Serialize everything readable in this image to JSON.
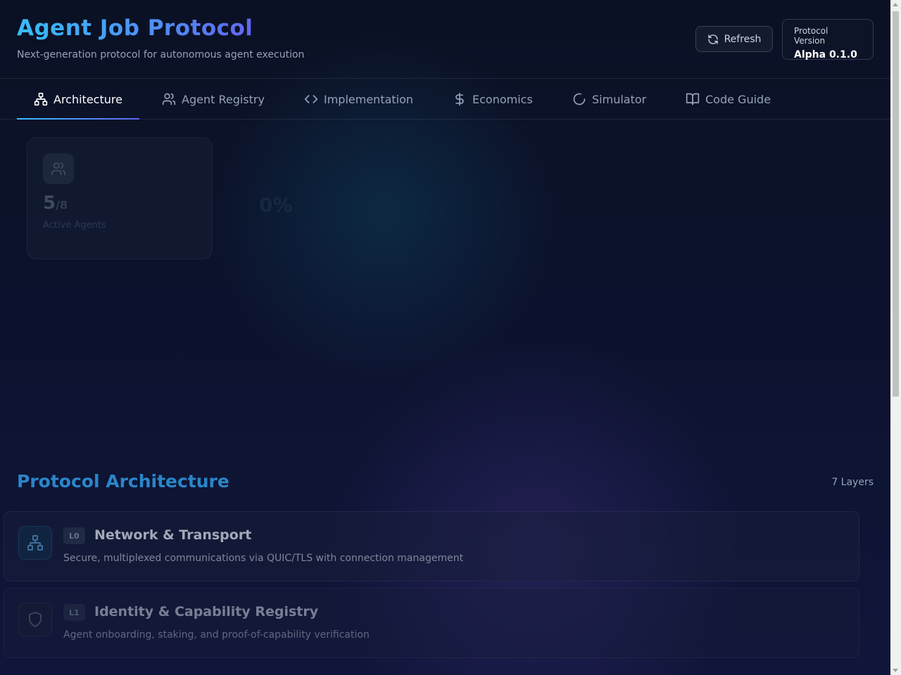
{
  "header": {
    "title": "Agent Job Protocol",
    "subtitle": "Next-generation protocol for autonomous agent execution",
    "refresh_label": "Refresh",
    "version_label": "Protocol Version",
    "version_value": "Alpha 0.1.0"
  },
  "tabs": [
    {
      "label": "Architecture",
      "icon": "network-icon",
      "active": true
    },
    {
      "label": "Agent Registry",
      "icon": "users-icon",
      "active": false
    },
    {
      "label": "Implementation",
      "icon": "code-icon",
      "active": false
    },
    {
      "label": "Economics",
      "icon": "dollar-icon",
      "active": false
    },
    {
      "label": "Simulator",
      "icon": "loader-icon",
      "active": false
    },
    {
      "label": "Code Guide",
      "icon": "book-icon",
      "active": false
    }
  ],
  "stats": [
    {
      "value": "5",
      "total": "/8",
      "label": "Active Agents",
      "icon": "users-icon"
    },
    {
      "value": "0%",
      "label": "",
      "icon": ""
    }
  ],
  "section": {
    "title": "Protocol Architecture",
    "count": "7 Layers"
  },
  "layers": [
    {
      "badge": "L0",
      "name": "Network & Transport",
      "description": "Secure, multiplexed communications via QUIC/TLS with connection management",
      "icon": "network-icon"
    },
    {
      "badge": "L1",
      "name": "Identity & Capability Registry",
      "description": "Agent onboarding, staking, and proof-of-capability verification",
      "icon": "shield-icon"
    }
  ],
  "colors": {
    "background": "#0b1023",
    "accent_start": "#38bdf8",
    "accent_end": "#6366f1",
    "section_title": "#2a86c9"
  }
}
